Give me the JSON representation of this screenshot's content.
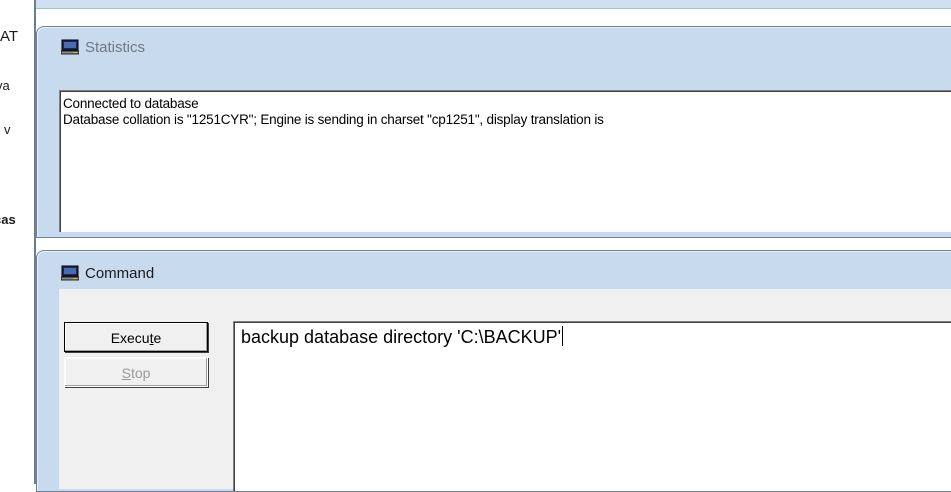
{
  "background_window": {
    "fragments": [
      "AT",
      "va",
      "v",
      "cas"
    ]
  },
  "statistics": {
    "title": "Statistics",
    "lines": [
      "Connected to database",
      "Database collation is \"1251CYR\"; Engine is sending in charset \"cp1251\", display translation is"
    ]
  },
  "command": {
    "title": "Command",
    "execute_label_pre": "Execu",
    "execute_label_key": "t",
    "execute_label_post": "e",
    "stop_label_key": "S",
    "stop_label_post": "top",
    "input_value": "backup database directory 'C:\\BACKUP'"
  },
  "colors": {
    "frame": "#c8daee",
    "disabled_text": "#9a9a9a"
  }
}
